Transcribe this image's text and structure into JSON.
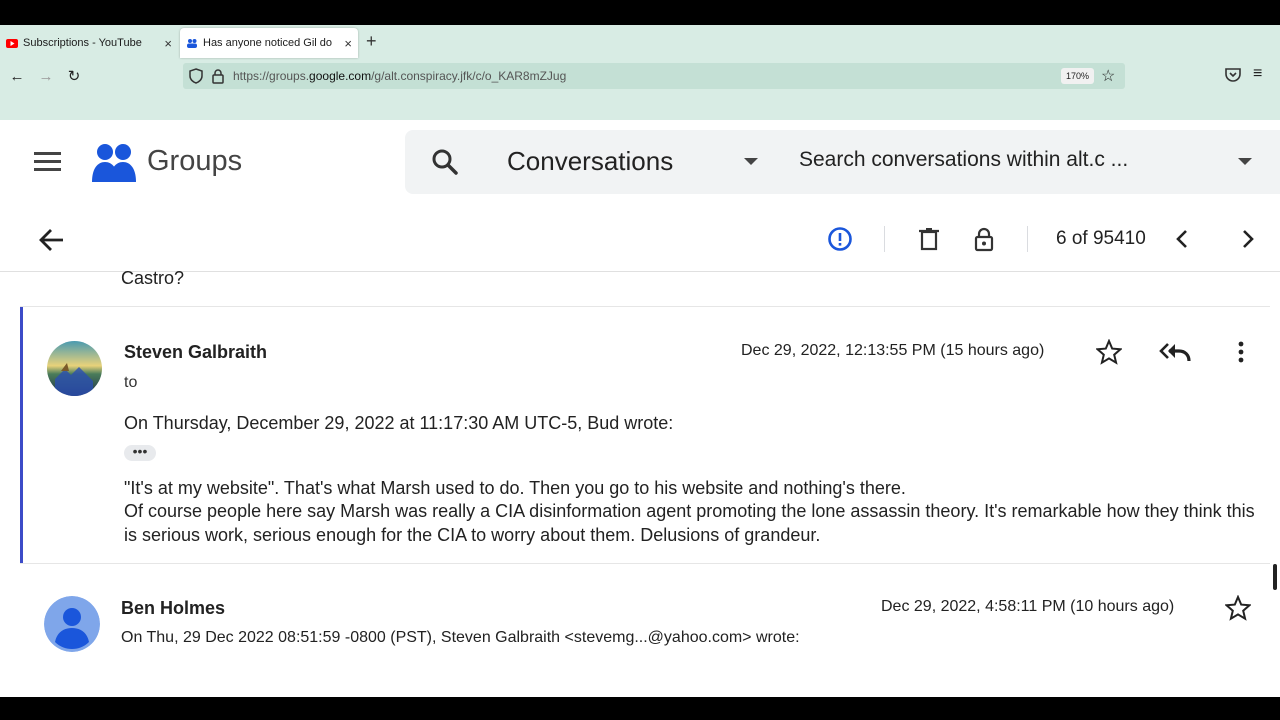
{
  "browser": {
    "tabs": [
      {
        "title": "Subscriptions - YouTube",
        "favicon": "youtube-icon"
      },
      {
        "title": "Has anyone noticed Gil do",
        "favicon": "groups-icon"
      }
    ],
    "url_prefix": "https://groups.",
    "url_domain": "google.com",
    "url_path": "/g/alt.conspiracy.jfk/c/o_KAR8mZJug",
    "zoom": "170%"
  },
  "app": {
    "brand": "Groups",
    "search_scope": "Conversations",
    "search_placeholder": "Search conversations within alt.c  ..."
  },
  "toolbar": {
    "count": "6 of 95410"
  },
  "thread": {
    "previous_tail": "Castro?",
    "messages": [
      {
        "author": "Steven Galbraith",
        "to": "to",
        "date": "Dec 29, 2022, 12:13:55 PM (15 hours ago)",
        "quote_header": "On Thursday, December 29, 2022 at 11:17:30 AM UTC-5, Bud wrote:",
        "ellipsis": "•••",
        "body_line1": "\"It's at my website\". That's what Marsh used to do. Then you go to his website and nothing's there.",
        "body_line2": "Of course people here say Marsh was really a CIA disinformation agent promoting the lone assassin theory. It's remarkable how they think this is serious work, serious enough for the CIA to worry about them. Delusions of grandeur."
      },
      {
        "author": "Ben Holmes",
        "date": "Dec 29, 2022, 4:58:11 PM (10 hours ago)",
        "preview": "On Thu, 29 Dec 2022 08:51:59 -0800 (PST), Steven Galbraith <stevemg...@yahoo.com> wrote:"
      }
    ]
  },
  "colors": {
    "accent": "#3c4bc8",
    "chrome_bg": "#d8ece4",
    "info_blue": "#1a56db"
  }
}
